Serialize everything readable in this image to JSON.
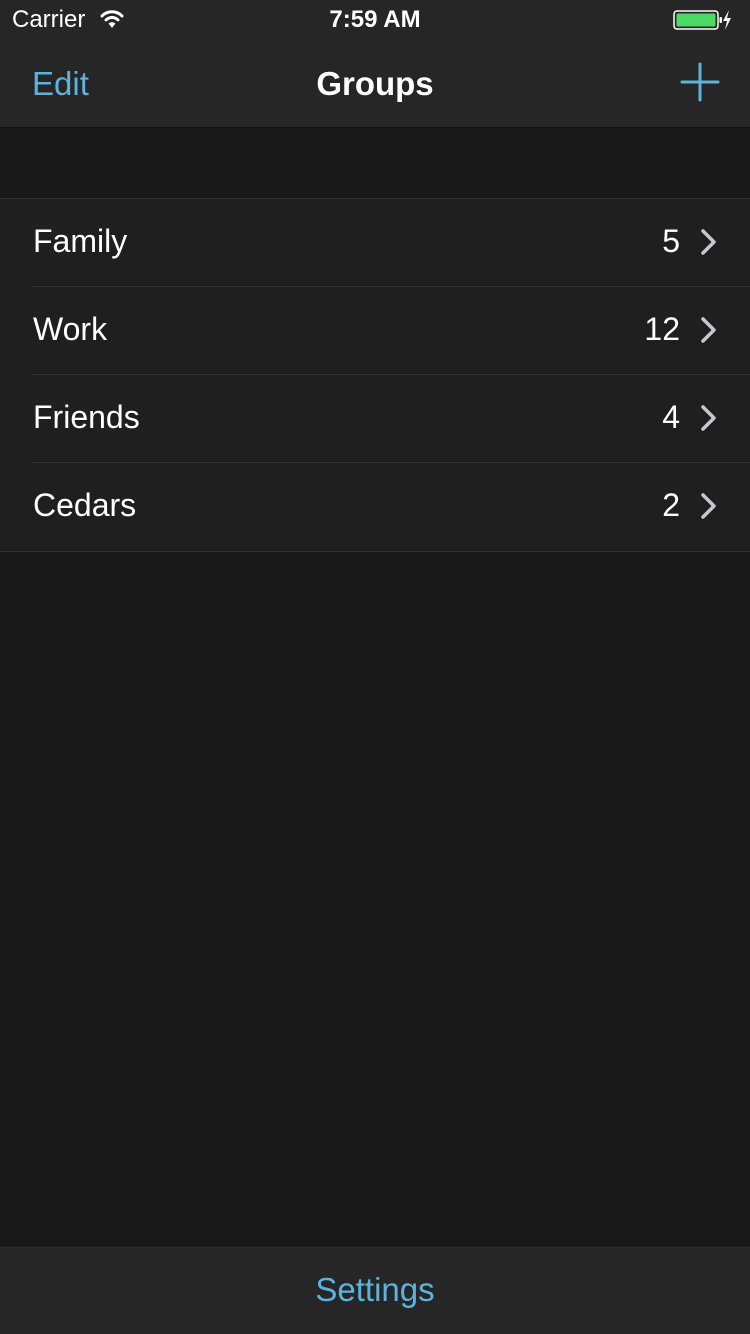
{
  "status_bar": {
    "carrier": "Carrier",
    "time": "7:59 AM",
    "wifi_icon": "wifi-icon",
    "battery_icon": "battery-charging-icon",
    "battery_color": "#4cd964"
  },
  "nav_bar": {
    "edit_label": "Edit",
    "title": "Groups",
    "add_icon": "plus-icon"
  },
  "groups": [
    {
      "label": "Family",
      "count": "5"
    },
    {
      "label": "Work",
      "count": "12"
    },
    {
      "label": "Friends",
      "count": "4"
    },
    {
      "label": "Cedars",
      "count": "2"
    }
  ],
  "toolbar": {
    "settings_label": "Settings"
  },
  "colors": {
    "accent": "#5db3dd",
    "background": "#191919",
    "bar_background": "#262626",
    "cell_background": "#1f1f1f",
    "separator": "#313131"
  }
}
